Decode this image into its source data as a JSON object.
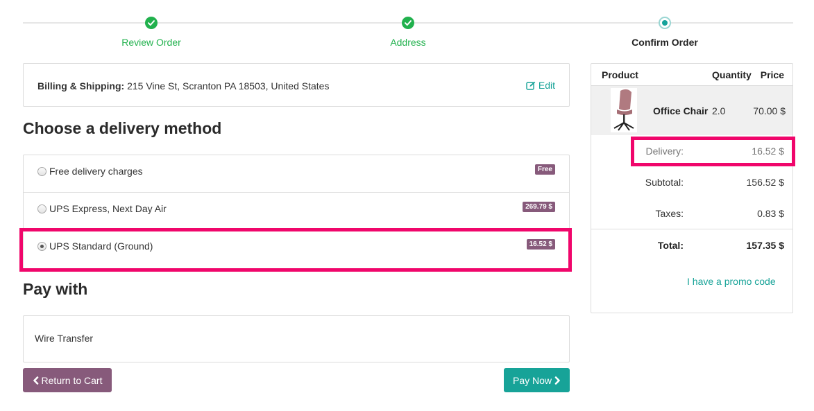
{
  "wizard": {
    "steps": [
      {
        "label": "Review Order",
        "state": "done"
      },
      {
        "label": "Address",
        "state": "done"
      },
      {
        "label": "Confirm Order",
        "state": "current"
      }
    ]
  },
  "address": {
    "label": "Billing & Shipping:",
    "value": "215 Vine St, Scranton PA 18503, United States",
    "edit_label": "Edit"
  },
  "delivery": {
    "title": "Choose a delivery method",
    "methods": [
      {
        "name": "Free delivery charges",
        "price": "Free",
        "selected": false
      },
      {
        "name": "UPS Express, Next Day Air",
        "price": "269.79 $",
        "selected": false
      },
      {
        "name": "UPS Standard (Ground)",
        "price": "16.52 $",
        "selected": true
      }
    ]
  },
  "payment": {
    "title": "Pay with",
    "method": "Wire Transfer"
  },
  "buttons": {
    "return_label": "Return to Cart",
    "pay_label": "Pay Now"
  },
  "summary": {
    "headers": {
      "product": "Product",
      "quantity": "Quantity",
      "price": "Price"
    },
    "product": {
      "name": "Office Chair",
      "quantity": "2.0",
      "price": "70.00 $"
    },
    "delivery_label": "Delivery:",
    "delivery_value": "16.52 $",
    "subtotal_label": "Subtotal:",
    "subtotal_value": "156.52 $",
    "taxes_label": "Taxes:",
    "taxes_value": "0.83 $",
    "total_label": "Total:",
    "total_value": "157.35 $",
    "promo_label": "I have a promo code"
  },
  "colors": {
    "success": "#21b14d",
    "primary": "#875a7b",
    "teal": "#17a398",
    "highlight": "#f0066b"
  }
}
